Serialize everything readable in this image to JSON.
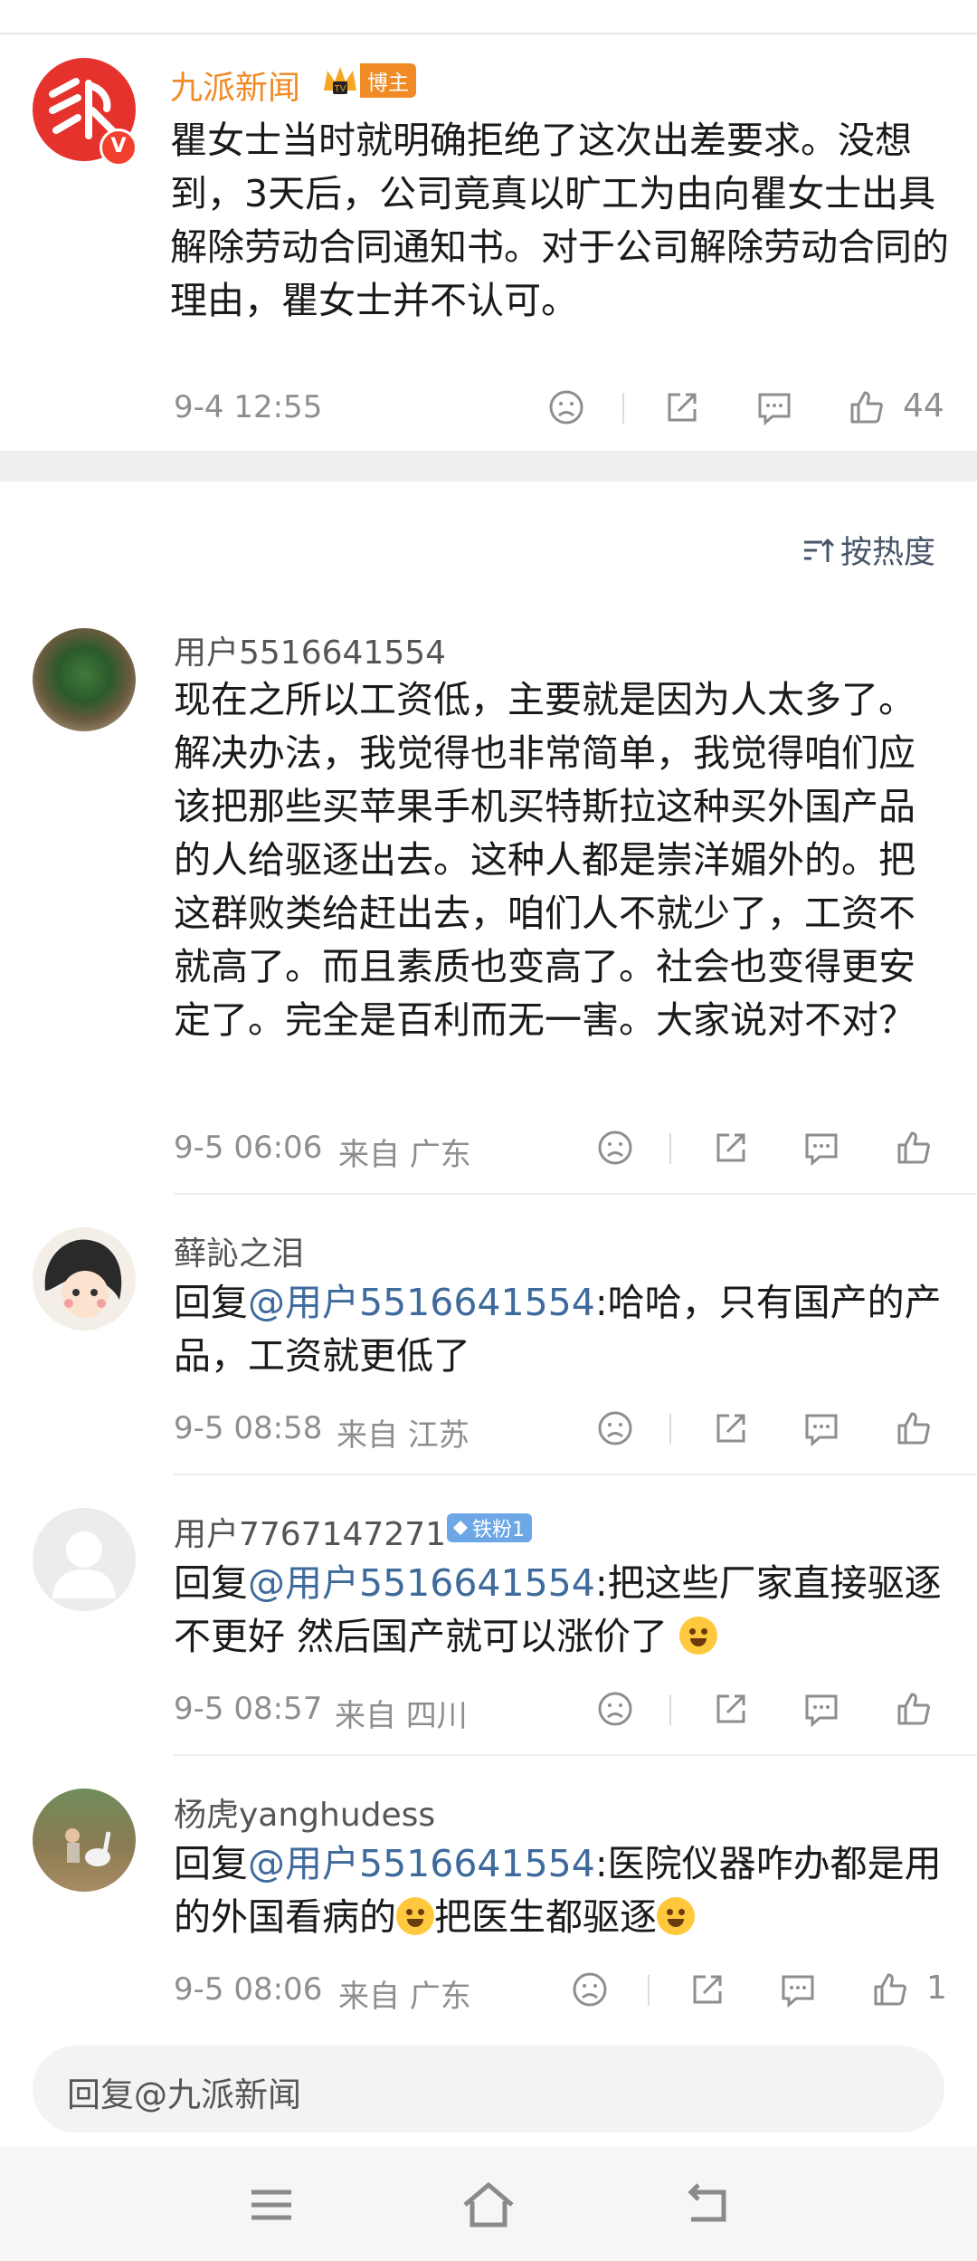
{
  "post": {
    "author": "九派新闻",
    "badge_label": "博主",
    "text": "瞿女士当时就明确拒绝了这次出差要求。没想到，3天后，公司竟真以旷工为由向瞿女士出具解除劳动合同通知书。对于公司解除劳动合同的理由，瞿女士并不认可。",
    "time": "9-4 12:55",
    "likes": "44"
  },
  "sort_label": "按热度",
  "comments": [
    {
      "user": "用户5516641554",
      "text": "现在之所以工资低，主要就是因为人太多了。解决办法，我觉得也非常简单，我觉得咱们应该把那些买苹果手机买特斯拉这种买外国产品的人给驱逐出去。这种人都是崇洋媚外的。把这群败类给赶出去，咱们人不就少了，工资不就高了。而且素质也变高了。社会也变得更安定了。完全是百利而无一害。大家说对不对？",
      "time": "9-5 06:06",
      "location": "来自 广东"
    },
    {
      "user": "藓訫之泪",
      "reply_prefix": "回复",
      "mention": "@用户5516641554",
      "text": ":哈哈，只有国产的产品，工资就更低了",
      "time": "9-5 08:58",
      "location": "来自 江苏"
    },
    {
      "user": "用户7767147271",
      "fan_badge": "铁粉1",
      "reply_prefix": "回复",
      "mention": "@用户5516641554",
      "text": ":把这些厂家直接驱逐不更好 然后国产就可以涨价了",
      "time": "9-5 08:57",
      "location": "来自 四川"
    },
    {
      "user": "杨虎yanghudess",
      "reply_prefix": "回复",
      "mention": "@用户5516641554",
      "text_a": ":医院仪器咋办都是用的外国看病的",
      "text_b": "把医生都驱逐",
      "time": "9-5 08:06",
      "location": "来自 广东",
      "likes": "1"
    }
  ],
  "reply_input": "回复@九派新闻",
  "icons": [
    "dislike-icon",
    "share-icon",
    "comment-icon",
    "like-icon",
    "sort-icon",
    "menu-icon",
    "home-icon",
    "back-icon"
  ],
  "colors": {
    "accent_orange": "#f08a24",
    "mention_blue": "#3e6a9c",
    "brand_red": "#e5322d"
  }
}
